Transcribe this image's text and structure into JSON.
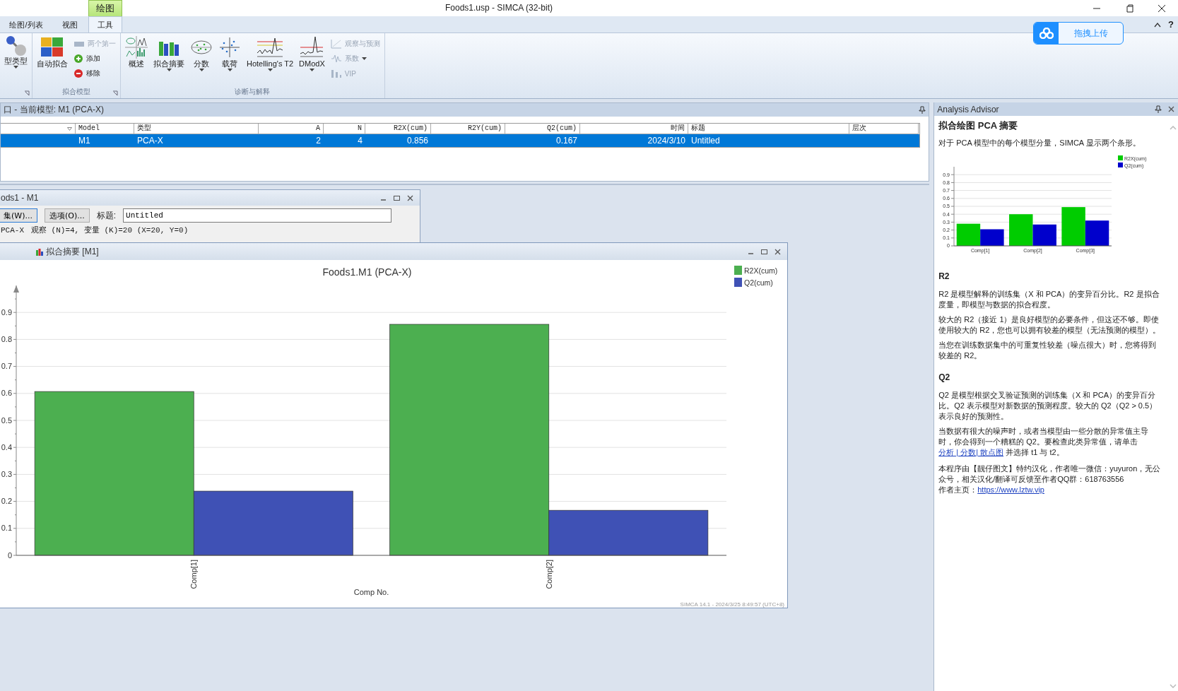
{
  "window": {
    "title": "Foods1.usp - SIMCA (32-bit)",
    "context_tab": "绘图",
    "help": "?"
  },
  "ribbon_tabs": [
    {
      "label": "绘图/列表",
      "selected": false
    },
    {
      "label": "视图",
      "selected": false
    },
    {
      "label": "工具",
      "selected": true
    }
  ],
  "upload_button": {
    "label": "拖拽上传"
  },
  "ribbon_groups": [
    {
      "launcher": true,
      "large": [
        {
          "label": "型类型",
          "dropdown": true
        }
      ]
    },
    {
      "label": "拟合模型",
      "launcher": true,
      "large": [
        {
          "label": "自动拟合",
          "dropdown": false
        }
      ],
      "small": [
        {
          "label": "两个第一",
          "disabled": true,
          "dropdown": false
        },
        {
          "label": "添加",
          "disabled": false,
          "dropdown": false
        },
        {
          "label": "移除",
          "disabled": false,
          "dropdown": false
        }
      ]
    },
    {
      "label": "诊断与解释",
      "launcher": false,
      "large": [
        {
          "label": "概述",
          "dropdown": false
        },
        {
          "label": "拟合摘要",
          "dropdown": true
        },
        {
          "label": "分数",
          "dropdown": true
        },
        {
          "label": "载荷",
          "dropdown": true
        },
        {
          "label": "Hotelling's T2",
          "dropdown": true
        },
        {
          "label": "DModX",
          "dropdown": true
        }
      ],
      "small": [
        {
          "label": "观察与预测",
          "disabled": true,
          "dropdown": false
        },
        {
          "label": "系数",
          "disabled": true,
          "dropdown": true
        },
        {
          "label": "VIP",
          "disabled": true,
          "dropdown": false
        }
      ]
    }
  ],
  "model_panel": {
    "title": "口 - 当前模型: M1 (PCA-X)",
    "columns": [
      "",
      "Model",
      "类型",
      "A",
      "N",
      "R2X(cum)",
      "R2Y(cum)",
      "Q2(cum)",
      "时间",
      "标题",
      "层次"
    ],
    "rows": [
      {
        "selected": true,
        "cells": [
          "",
          "M1",
          "PCA-X",
          "2",
          "4",
          "0.856",
          "",
          "0.167",
          "2024/3/10",
          "Untitled",
          ""
        ]
      }
    ]
  },
  "model_window": {
    "title": "ods1 - M1",
    "buttons": [
      "集(W)...",
      "选项(O)..."
    ],
    "title_label": "标题:",
    "title_value": "Untitled",
    "model_type": "PCA-X",
    "summary": "观察 (N)=4, 变量 (K)=20 (X=20, Y=0)"
  },
  "chart_window": {
    "title": "拟合摘要 [M1]",
    "footer": "SIMCA 14.1 - 2024/3/25 8:49:57 (UTC+8)",
    "chart_data": {
      "type": "bar",
      "title": "Foods1.M1 (PCA-X)",
      "xlabel": "Comp No.",
      "categories": [
        "Comp[1]",
        "Comp[2]"
      ],
      "series": [
        {
          "name": "R2X(cum)",
          "color": "#4caf50",
          "values": [
            0.607,
            0.856
          ]
        },
        {
          "name": "Q2(cum)",
          "color": "#3f51b5",
          "values": [
            0.238,
            0.167
          ]
        }
      ],
      "ylim": [
        0,
        1
      ],
      "yticks": [
        0,
        0.1,
        0.2,
        0.3,
        0.4,
        0.5,
        0.6,
        0.7,
        0.8,
        0.9
      ],
      "grid": true,
      "legend": "top-right"
    }
  },
  "advisor": {
    "title": "Analysis Advisor",
    "heading": "拟合绘图 PCA 摘要",
    "intro": "对于 PCA 模型中的每个模型分量，SIMCA 显示两个条形。",
    "chart_data": {
      "type": "bar",
      "categories": [
        "Comp[1]",
        "Comp[2]",
        "Comp[3]"
      ],
      "series": [
        {
          "name": "R2X(cum)",
          "color": "#00cc00",
          "values": [
            0.28,
            0.4,
            0.49
          ]
        },
        {
          "name": "Q2(cum)",
          "color": "#0000cc",
          "values": [
            0.21,
            0.27,
            0.32
          ]
        }
      ],
      "ylim": [
        0,
        1
      ],
      "yticks": [
        0,
        0.1,
        0.2,
        0.3,
        0.4,
        0.5,
        0.6,
        0.7,
        0.8,
        0.9
      ],
      "grid": true,
      "legend": "top-right"
    },
    "sections": [
      {
        "heading": "R2",
        "paragraphs": [
          {
            "text": "R2 是模型解释的训练集（X 和 PCA）的变异百分比。R2 是拟合度量，即模型与数据的拟合程度。"
          },
          {
            "text": "较大的 R2（接近 1）是良好模型的必要条件，但这还不够。即使使用较大的 R2，您也可以拥有较差的模型（无法预测的模型）。"
          },
          {
            "text": "当您在训练数据集中的可重复性较差（噪点很大）时，您将得到较差的 R2。"
          }
        ]
      },
      {
        "heading": "Q2",
        "paragraphs": [
          {
            "text": "Q2 是模型根据交叉验证预测的训练集（X 和 PCA）的变异百分比。Q2 表示模型对新数据的预测程度。较大的 Q2（Q2 > 0.5）表示良好的预测性。"
          },
          {
            "text": "当数据有很大的噪声时，或者当模型由一些分散的异常值主导时，你会得到一个糟糕的 Q2。要检查此类异常值，请单击 ",
            "link": "分析 | 分数| 散点图",
            "after": " 并选择 t1 与 t2。"
          }
        ]
      }
    ],
    "credits": {
      "text": "本程序由【靓仔图文】特约汉化，作者唯一微信：yuyuron，无公众号，相关汉化/翻译可反馈至作者QQ群：618763556",
      "homepage_label": "作者主页：",
      "homepage_link": "https://www.lztw.vip"
    }
  }
}
